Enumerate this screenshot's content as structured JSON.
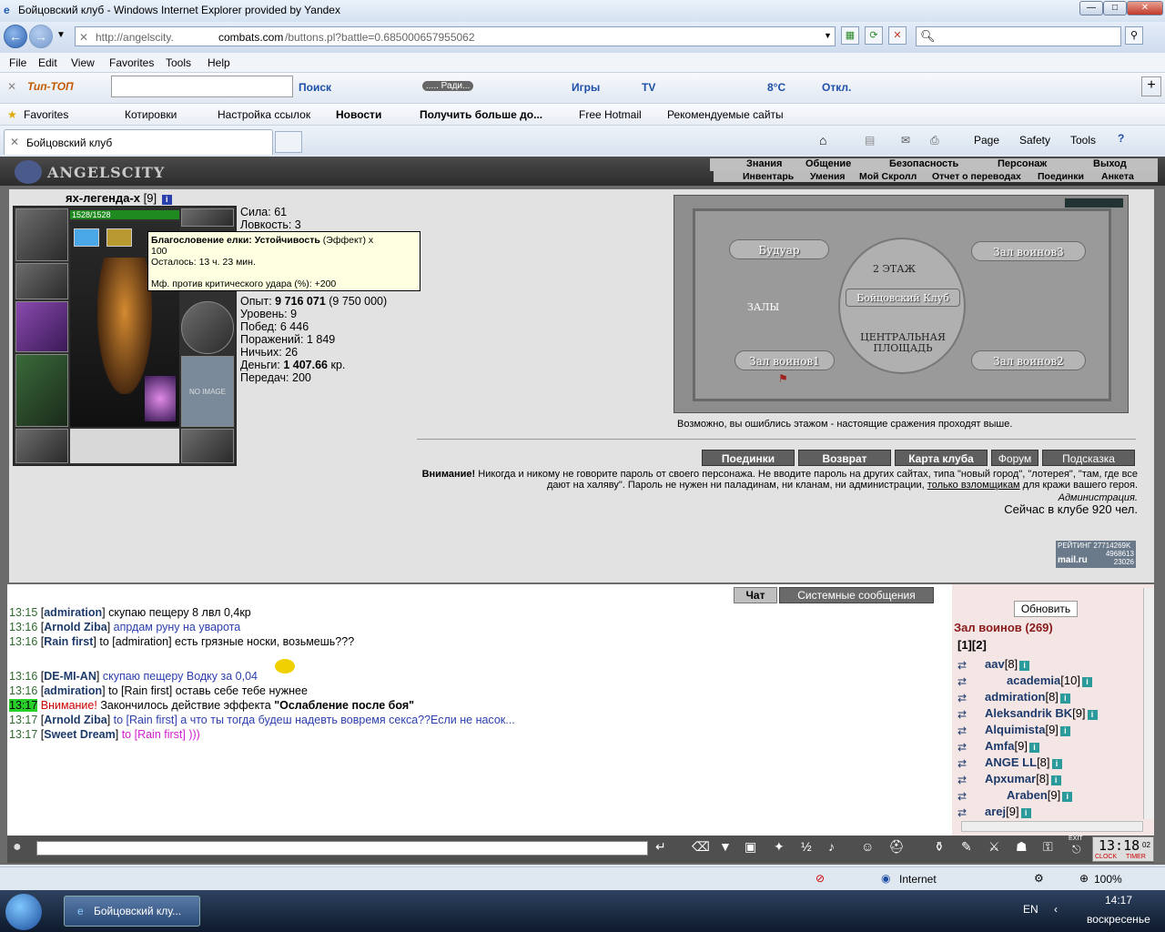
{
  "window": {
    "title": "Бойцовский клуб - Windows Internet Explorer provided by Yandex"
  },
  "address": {
    "prefix": "http://angelscity.",
    "domain": "combats.com",
    "path": "/buttons.pl?battle=0.685000657955062"
  },
  "menu": [
    "File",
    "Edit",
    "View",
    "Favorites",
    "Tools",
    "Help"
  ],
  "toolbar": {
    "brand": "Тип-ТОП",
    "search_label": "Поиск",
    "radio": "..... Ради...",
    "games": "Игры",
    "tv": "TV",
    "weather": "8°C",
    "off": "Откл."
  },
  "favorites": {
    "label": "Favorites",
    "items": [
      "Котировки",
      "Настройка ссылок",
      "Новости",
      "Получить больше до...",
      "Free Hotmail",
      "Рекомендуемые сайты"
    ]
  },
  "tab": {
    "title": "Бойцовский клуб"
  },
  "ietools": [
    "Page",
    "Safety",
    "Tools"
  ],
  "game": {
    "logo": "ANGELSCITY",
    "nav": [
      "Знания",
      "Общение",
      "Безопасность",
      "Персонаж",
      "Выход"
    ],
    "subnav": [
      "Инвентарь",
      "Умения",
      "Мой Скролл",
      "Отчет о переводах",
      "Поединки",
      "Анкета"
    ],
    "char_name": "ях-легенда-х",
    "char_level": "[9]",
    "hp": "1528/1528",
    "noimage": "NO IMAGE",
    "stats": {
      "strength": "Сила: 61",
      "agility": "Ловкость: 3",
      "exp_label": "Опыт: ",
      "exp": "9 716 071",
      "exp_next": " (9 750 000)",
      "level": "Уровень: 9",
      "wins": "Побед: 6 446",
      "losses": "Поражений: 1 849",
      "draws": "Ничьих: 26",
      "money_label": "Деньги: ",
      "money": "1 407.66",
      "money_unit": " кр.",
      "transfers": "Передач: 200"
    },
    "tooltip": {
      "title": "Благословение елки: Устойчивость",
      "kind": " (Эффект) x",
      "count": "100",
      "remain": "Осталось: 13 ч. 23 мин.",
      "mf": "Мф. против критического удара (%): +200"
    },
    "map": {
      "floor": "2 ЭТАЖ",
      "club": "Бойцовский Клуб",
      "halls": "ЗАЛЫ",
      "square": "ЦЕНТРАЛЬНАЯ ПЛОЩАДЬ",
      "r1": "Будуар",
      "r2": "Зал воинов3",
      "r3": "Зал воинов1",
      "r4": "Зал воинов2",
      "note": "Возможно, вы ошиблись этажом - настоящие сражения проходят выше."
    },
    "buttons": [
      "Поединки",
      "Возврат",
      "Карта клуба",
      "Форум",
      "Подсказка"
    ],
    "warning": {
      "bold": "Внимание!",
      "text": " Никогда и никому не говорите пароль от своего персонажа. Не вводите пароль на других сайтах, типа \"новый город\", \"лотерея\", \"там, где все дают на халяву\". Пароль не нужен ни паладинам, ни кланам, ни администрации, ",
      "link": "только взломщикам",
      "tail": " для кражи вашего героя.",
      "admin": "Администрация.",
      "online": "Сейчас в клубе 920 чел."
    },
    "rating": {
      "label": "РЕЙТИНГ 27714269K",
      "n1": "4968613",
      "n2": "23026",
      "brand": "mail.ru"
    },
    "chat_tabs": [
      "Чат",
      "Системные сообщения"
    ],
    "chat": [
      {
        "t": "13:15",
        "n": "admiration",
        "m": " скупаю пещеру 8 лвл 0,4кр"
      },
      {
        "t": "13:16",
        "n": "Arnold Ziba",
        "m": " апрдам руну на уварота"
      },
      {
        "t": "13:16",
        "n": "Rain first",
        "m": " to [admiration] есть грязные носки, возьмешь???"
      },
      {
        "t": "13:16",
        "n": "DE-MI-AN",
        "m": " скупаю пещеру Водку       за 0,04"
      },
      {
        "t": "13:16",
        "n": "admiration",
        "m": " to [Rain first] оставь себе тебе нужнее"
      },
      {
        "t": "13:17",
        "n": "Arnold Ziba",
        "m": " to [Rain first] а что ты тогда будеш надевть вовремя секса??Если не насок..."
      },
      {
        "t": "13:17",
        "n": "Sweet Dream",
        "m": " to [Rain first] )))"
      }
    ],
    "sys": {
      "t": "13:17",
      "warn": "Внимание!",
      "text": " Закончилось действие эффекта ",
      "effect": "\"Ослабление после боя\""
    },
    "userlist": {
      "refresh": "Обновить",
      "room": "Зал воинов (269)",
      "pages": "[1][2]",
      "users": [
        {
          "n": "aav",
          "l": "[8]"
        },
        {
          "n": "academia",
          "l": "[10]"
        },
        {
          "n": "admiration",
          "l": "[8]"
        },
        {
          "n": "Aleksandrik BK",
          "l": "[9]"
        },
        {
          "n": "Alquimista",
          "l": "[9]"
        },
        {
          "n": "Amfa",
          "l": "[9]"
        },
        {
          "n": "ANGE LL",
          "l": "[8]"
        },
        {
          "n": "Архumar",
          "l": "[8]"
        },
        {
          "n": "Araben",
          "l": "[9]"
        },
        {
          "n": "arej",
          "l": "[9]"
        }
      ]
    },
    "clock": "13:18",
    "clock_sec": "02",
    "clock_lbl": "CLOCK",
    "timer_lbl": "TIMER",
    "exit": "EXIT"
  },
  "status": {
    "zone": "Internet",
    "zoom": "100%"
  },
  "taskbar": {
    "app": "Бойцовский клу...",
    "lang": "EN",
    "time": "14:17",
    "day": "воскресенье"
  }
}
